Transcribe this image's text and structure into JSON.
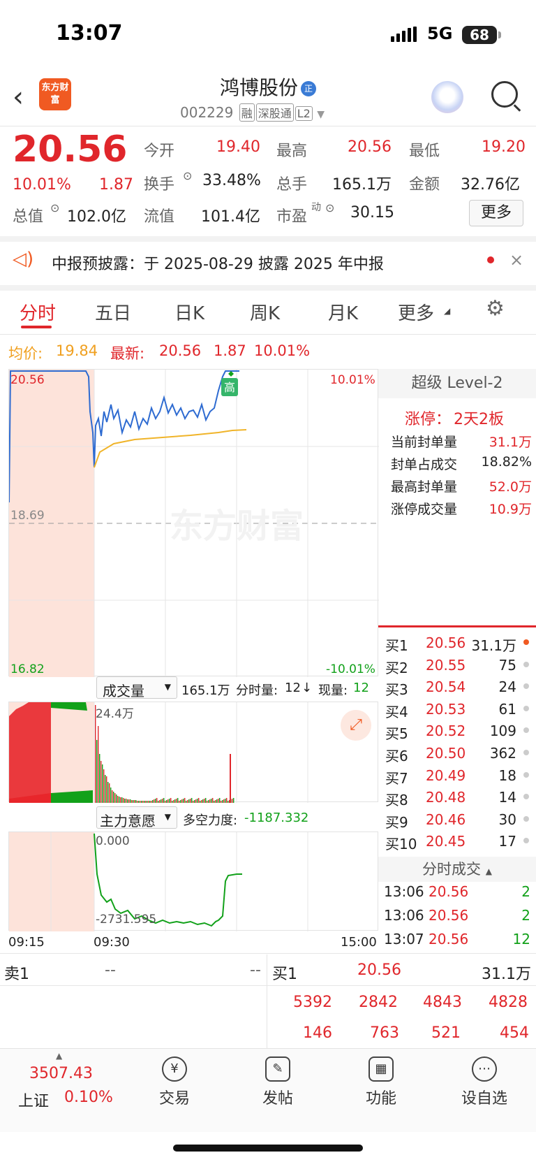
{
  "status": {
    "time": "13:07",
    "network": "5G",
    "battery": "68"
  },
  "header": {
    "logo_text": "东方财富",
    "stock_name": "鸿博股份",
    "name_badge": "正",
    "code": "002229",
    "tags": [
      "融",
      "深股通",
      "L2"
    ]
  },
  "quote": {
    "price": "20.56",
    "change_pct": "10.01%",
    "change": "1.87",
    "open_label": "今开",
    "open": "19.40",
    "high_label": "最高",
    "high": "20.56",
    "low_label": "最低",
    "low": "19.20",
    "turnover_label": "换手",
    "turnover": "33.48%",
    "volume_label": "总手",
    "volume": "165.1万",
    "amount_label": "金额",
    "amount": "32.76亿",
    "mktcap_label": "总值",
    "mktcap": "102.0亿",
    "float_label": "流值",
    "float": "101.4亿",
    "pe_label": "市盈",
    "pe_sup": "动",
    "pe": "30.15",
    "more_btn": "更多"
  },
  "notice": {
    "text": "中报预披露：于 2025-08-29 披露 2025 年中报"
  },
  "tabs": [
    "分时",
    "五日",
    "日K",
    "周K",
    "月K",
    "更多"
  ],
  "chart_info": {
    "avg_label": "均价:",
    "avg": "19.84",
    "last_label": "最新:",
    "last": "20.56",
    "chg": "1.87",
    "pct": "10.01%"
  },
  "chart_data": {
    "type": "line",
    "price_axis": {
      "top": "20.56",
      "mid": "18.69",
      "bottom": "16.82",
      "top_pct": "10.01%",
      "bottom_pct": "-10.01%"
    },
    "high_marker": "高",
    "watermark": "东方财富",
    "x_ticks": [
      "09:15",
      "09:30",
      "15:00"
    ],
    "series": [
      {
        "name": "price",
        "color": "#2e6bd1"
      },
      {
        "name": "avg",
        "color": "#f0b429"
      }
    ]
  },
  "volume_panel": {
    "selector": "成交量",
    "total": "165.1万",
    "tick_label": "分时量:",
    "tick_val": "12",
    "cur_label": "现量:",
    "cur_val": "12",
    "peak": "24.4万"
  },
  "main_panel": {
    "selector": "主力意愿",
    "force_label": "多空力度:",
    "force_val": "-1187.332",
    "top": "0.000",
    "bottom": "-2731.595"
  },
  "level2": {
    "title": "超级 Level-2",
    "limit_label": "涨停：",
    "limit_val": "2天2板",
    "rows": [
      {
        "label": "当前封单量",
        "val": "31.1万"
      },
      {
        "label": "封单占成交",
        "val": "18.82%"
      },
      {
        "label": "最高封单量",
        "val": "52.0万"
      },
      {
        "label": "涨停成交量",
        "val": "10.9万"
      }
    ]
  },
  "orderbook": [
    {
      "label": "买1",
      "price": "20.56",
      "qty": "31.1万"
    },
    {
      "label": "买2",
      "price": "20.55",
      "qty": "75"
    },
    {
      "label": "买3",
      "price": "20.54",
      "qty": "24"
    },
    {
      "label": "买4",
      "price": "20.53",
      "qty": "61"
    },
    {
      "label": "买5",
      "price": "20.52",
      "qty": "109"
    },
    {
      "label": "买6",
      "price": "20.50",
      "qty": "362"
    },
    {
      "label": "买7",
      "price": "20.49",
      "qty": "18"
    },
    {
      "label": "买8",
      "price": "20.48",
      "qty": "14"
    },
    {
      "label": "买9",
      "price": "20.46",
      "qty": "30"
    },
    {
      "label": "买10",
      "price": "20.45",
      "qty": "17"
    }
  ],
  "ticks": {
    "title": "分时成交",
    "rows": [
      {
        "time": "13:06",
        "price": "20.56",
        "qty": "2"
      },
      {
        "time": "13:06",
        "price": "20.56",
        "qty": "2"
      },
      {
        "time": "13:07",
        "price": "20.56",
        "qty": "12"
      }
    ]
  },
  "bottom_quote": {
    "sell_label": "卖1",
    "sell_a": "--",
    "sell_b": "--",
    "buy_label": "买1",
    "buy_price": "20.56",
    "buy_qty": "31.1万",
    "row1": [
      "5392",
      "2842",
      "4843",
      "4828"
    ],
    "row2": [
      "146",
      "763",
      "521",
      "454"
    ]
  },
  "tabbar": {
    "index_val": "3507.43",
    "index_name": "上证",
    "index_pct": "0.10%",
    "items": [
      "交易",
      "发帖",
      "功能",
      "设自选"
    ]
  }
}
